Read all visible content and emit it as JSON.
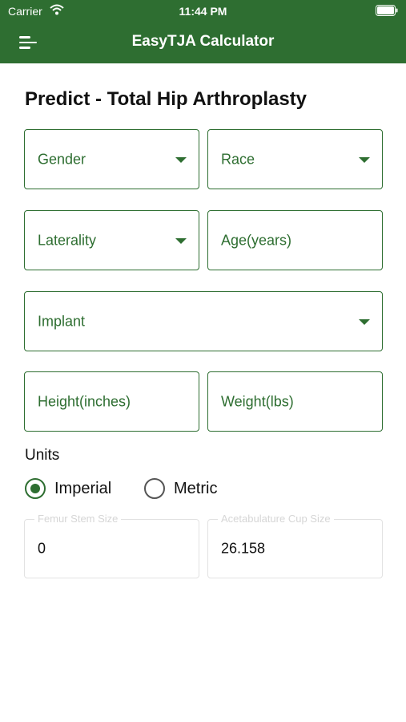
{
  "status": {
    "carrier": "Carrier",
    "time": "11:44 PM"
  },
  "nav": {
    "title": "EasyTJA Calculator",
    "menu_icon": "menu-icon"
  },
  "page": {
    "title": "Predict - Total Hip Arthroplasty"
  },
  "form": {
    "gender": "Gender",
    "race": "Race",
    "laterality": "Laterality",
    "age_placeholder": "Age(years)",
    "implant": "Implant",
    "height_placeholder": "Height(inches)",
    "weight_placeholder": "Weight(lbs)"
  },
  "units": {
    "label": "Units",
    "options": [
      "Imperial",
      "Metric"
    ],
    "selected": "Imperial"
  },
  "results": {
    "femur": {
      "label": "Femur Stem Size",
      "value": "0"
    },
    "cup": {
      "label": "Acetabulature Cup Size",
      "value": "26.158"
    }
  },
  "colors": {
    "primary": "#2e6e31",
    "disabled_border": "#e2e2e2"
  }
}
